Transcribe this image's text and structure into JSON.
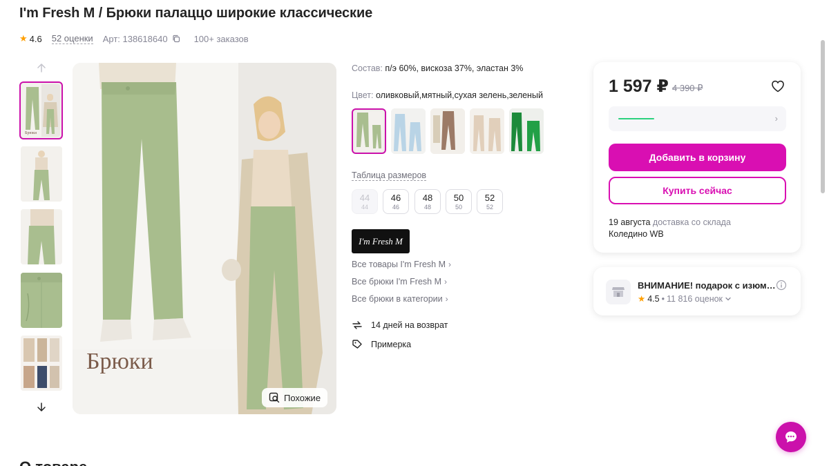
{
  "product": {
    "title": "I'm Fresh M / Брюки палаццо широкие классические",
    "rating": "4.6",
    "reviews": "52 оценки",
    "article": "Арт: 138618640",
    "orders": "100+ заказов"
  },
  "gallery": {
    "main_caption": "Брюки",
    "similar_label": "Похожие",
    "thumb_caption": "Брюки"
  },
  "details": {
    "composition_label": "Состав:",
    "composition_value": " п/э 60%, вискоза 37%, эластан 3%",
    "color_label": "Цвет:",
    "color_value": " оливковый,мятный,сухая зелень,зеленый",
    "size_table": "Таблица размеров",
    "sizes": [
      {
        "a": "44",
        "b": "44"
      },
      {
        "a": "46",
        "b": "46"
      },
      {
        "a": "48",
        "b": "48"
      },
      {
        "a": "50",
        "b": "50"
      },
      {
        "a": "52",
        "b": "52"
      }
    ],
    "brand_logo_text": "I'm Fresh M",
    "links": [
      "Все товары I'm Fresh M",
      "Все брюки I'm Fresh M",
      "Все брюки в категории"
    ],
    "return_label": "14 дней на возврат",
    "fitting_label": "Примерка"
  },
  "buy": {
    "price": "1 597 ₽",
    "old_price": "4 390 ₽",
    "add_to_cart": "Добавить в корзину",
    "buy_now": "Купить сейчас",
    "delivery_date": "19 августа",
    "delivery_text": " доставка со склада",
    "delivery_warehouse": "Коледино WB"
  },
  "shop": {
    "name": "ВНИМАНИЕ! подарок с изюм…",
    "rating": "4.5",
    "reviews": "11 816 оценок"
  },
  "section_heading": "О товаре",
  "colors": {
    "accent": "#cb11ab",
    "button": "#d90fb2",
    "star": "#ff9f00",
    "green_line": "#2ad17e"
  }
}
